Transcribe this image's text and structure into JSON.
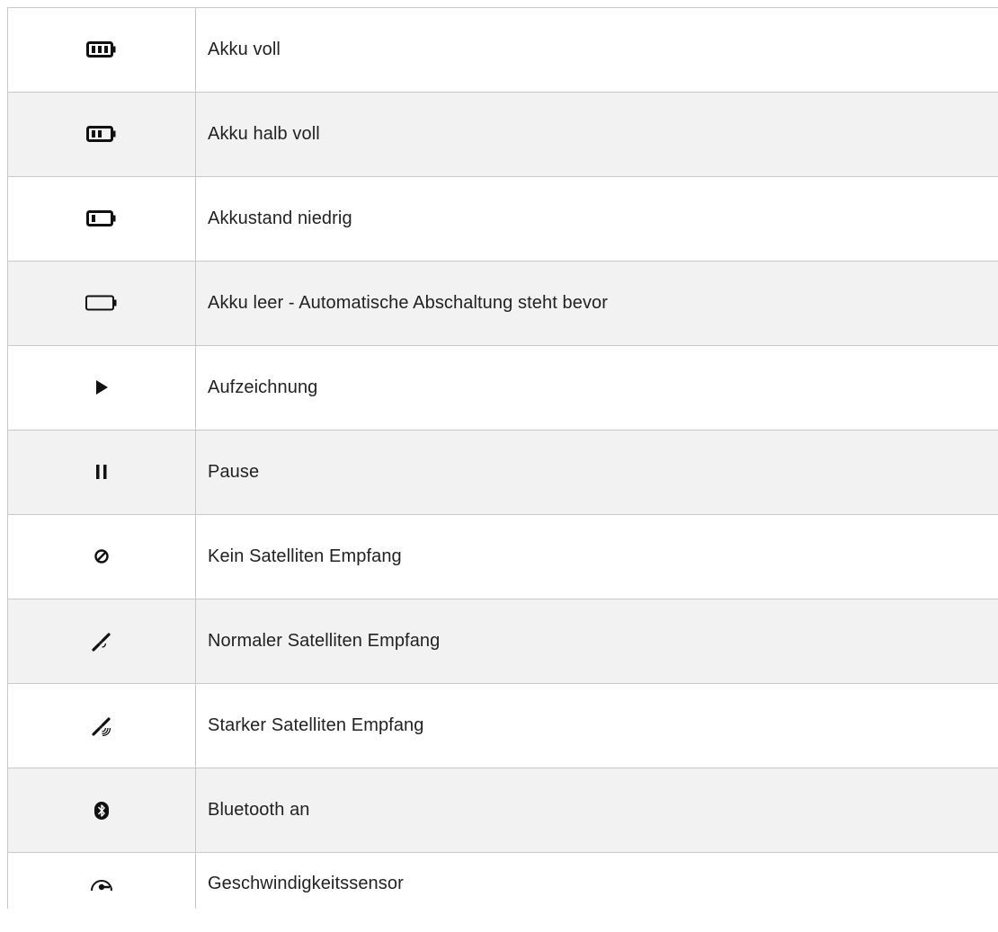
{
  "table": {
    "rows": [
      {
        "icon": "battery-full-icon",
        "label": "Akku voll"
      },
      {
        "icon": "battery-half-icon",
        "label": "Akku halb voll"
      },
      {
        "icon": "battery-low-icon",
        "label": "Akkustand niedrig"
      },
      {
        "icon": "battery-empty-icon",
        "label": "Akku leer - Automatische Abschaltung steht bevor"
      },
      {
        "icon": "play-icon",
        "label": "Aufzeichnung"
      },
      {
        "icon": "pause-icon",
        "label": "Pause"
      },
      {
        "icon": "no-signal-icon",
        "label": "Kein Satelliten Empfang"
      },
      {
        "icon": "satellite-normal-icon",
        "label": "Normaler Satelliten Empfang"
      },
      {
        "icon": "satellite-strong-icon",
        "label": "Starker Satelliten Empfang"
      },
      {
        "icon": "bluetooth-icon",
        "label": "Bluetooth an"
      },
      {
        "icon": "speed-sensor-icon",
        "label": "Geschwindigkeitssensor"
      }
    ]
  }
}
